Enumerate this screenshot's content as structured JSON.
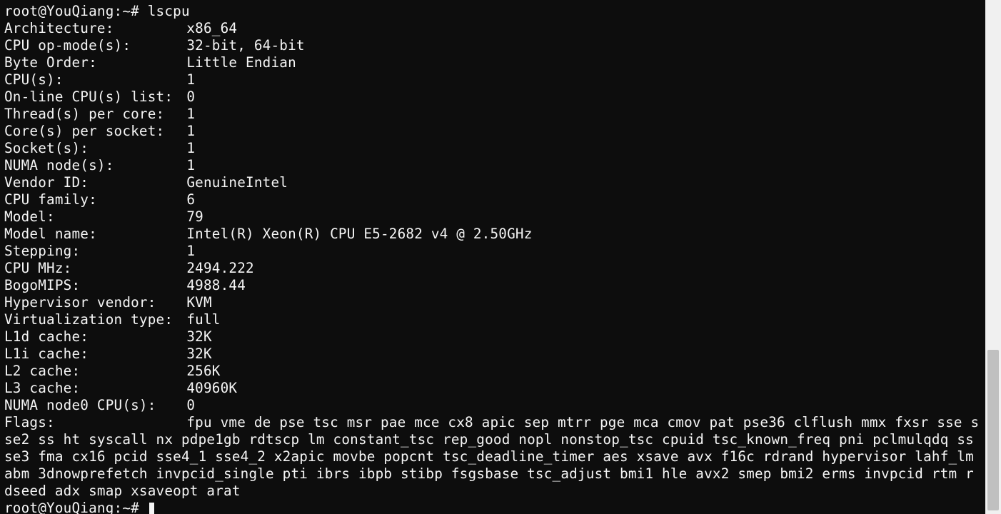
{
  "prompt1": "root@YouQiang:~# ",
  "command": "lscpu",
  "rows": [
    {
      "label": "Architecture:",
      "value": "x86_64"
    },
    {
      "label": "CPU op-mode(s):",
      "value": "32-bit, 64-bit"
    },
    {
      "label": "Byte Order:",
      "value": "Little Endian"
    },
    {
      "label": "CPU(s):",
      "value": "1"
    },
    {
      "label": "On-line CPU(s) list:",
      "value": "0"
    },
    {
      "label": "Thread(s) per core:",
      "value": "1"
    },
    {
      "label": "Core(s) per socket:",
      "value": "1"
    },
    {
      "label": "Socket(s):",
      "value": "1"
    },
    {
      "label": "NUMA node(s):",
      "value": "1"
    },
    {
      "label": "Vendor ID:",
      "value": "GenuineIntel"
    },
    {
      "label": "CPU family:",
      "value": "6"
    },
    {
      "label": "Model:",
      "value": "79"
    },
    {
      "label": "Model name:",
      "value": "Intel(R) Xeon(R) CPU E5-2682 v4 @ 2.50GHz"
    },
    {
      "label": "Stepping:",
      "value": "1"
    },
    {
      "label": "CPU MHz:",
      "value": "2494.222"
    },
    {
      "label": "BogoMIPS:",
      "value": "4988.44"
    },
    {
      "label": "Hypervisor vendor:",
      "value": "KVM"
    },
    {
      "label": "Virtualization type:",
      "value": "full"
    },
    {
      "label": "L1d cache:",
      "value": "32K"
    },
    {
      "label": "L1i cache:",
      "value": "32K"
    },
    {
      "label": "L2 cache:",
      "value": "256K"
    },
    {
      "label": "L3 cache:",
      "value": "40960K"
    },
    {
      "label": "NUMA node0 CPU(s):",
      "value": "0"
    }
  ],
  "flagsLabel": "Flags:",
  "flagsValue": "fpu vme de pse tsc msr pae mce cx8 apic sep mtrr pge mca cmov pat pse36 clflush mmx fxsr sse sse2 ss ht syscall nx pdpe1gb rdtscp lm constant_tsc rep_good nopl nonstop_tsc cpuid tsc_known_freq pni pclmulqdq ssse3 fma cx16 pcid sse4_1 sse4_2 x2apic movbe popcnt tsc_deadline_timer aes xsave avx f16c rdrand hypervisor lahf_lm abm 3dnowprefetch invpcid_single pti ibrs ibpb stibp fsgsbase tsc_adjust bmi1 hle avx2 smep bmi2 erms invpcid rtm rdseed adx smap xsaveopt arat",
  "prompt2": "root@YouQiang:~# "
}
